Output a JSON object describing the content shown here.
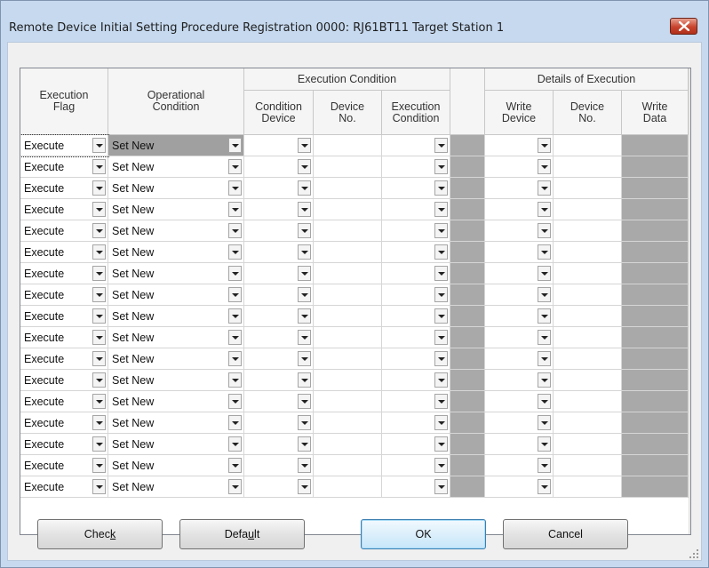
{
  "window": {
    "title": "Remote Device Initial Setting Procedure Registration 0000: RJ61BT11 Target Station 1"
  },
  "grid": {
    "group_headers": {
      "execution_condition": "Execution Condition",
      "details_of_execution": "Details of Execution"
    },
    "columns": {
      "execution_flag": [
        "Execution",
        "Flag"
      ],
      "operational_condition": [
        "Operational",
        "Condition"
      ],
      "condition_device": [
        "Condition",
        "Device"
      ],
      "device_no": [
        "Device",
        "No."
      ],
      "execution_condition": [
        "Execution",
        "Condition"
      ],
      "write_device": [
        "Write",
        "Device"
      ],
      "device_no_2": [
        "Device",
        "No."
      ],
      "write_data": [
        "Write",
        "Data"
      ]
    },
    "rows": [
      {
        "execution_flag": "Execute",
        "operational_condition": "Set New"
      },
      {
        "execution_flag": "Execute",
        "operational_condition": "Set New"
      },
      {
        "execution_flag": "Execute",
        "operational_condition": "Set New"
      },
      {
        "execution_flag": "Execute",
        "operational_condition": "Set New"
      },
      {
        "execution_flag": "Execute",
        "operational_condition": "Set New"
      },
      {
        "execution_flag": "Execute",
        "operational_condition": "Set New"
      },
      {
        "execution_flag": "Execute",
        "operational_condition": "Set New"
      },
      {
        "execution_flag": "Execute",
        "operational_condition": "Set New"
      },
      {
        "execution_flag": "Execute",
        "operational_condition": "Set New"
      },
      {
        "execution_flag": "Execute",
        "operational_condition": "Set New"
      },
      {
        "execution_flag": "Execute",
        "operational_condition": "Set New"
      },
      {
        "execution_flag": "Execute",
        "operational_condition": "Set New"
      },
      {
        "execution_flag": "Execute",
        "operational_condition": "Set New"
      },
      {
        "execution_flag": "Execute",
        "operational_condition": "Set New"
      },
      {
        "execution_flag": "Execute",
        "operational_condition": "Set New"
      },
      {
        "execution_flag": "Execute",
        "operational_condition": "Set New"
      },
      {
        "execution_flag": "Execute",
        "operational_condition": "Set New"
      }
    ],
    "selected_row": 1
  },
  "buttons": {
    "check": "Check",
    "default": "Default",
    "ok": "OK",
    "cancel": "Cancel"
  },
  "colors": {
    "title_bar": "#c6d9ef",
    "gray_cell": "#a9a9a9",
    "selected_cell": "#a0a0a0"
  },
  "icons": {
    "close": "close-icon",
    "dropdown": "chevron-down-icon",
    "scroll_up": "scroll-up-icon",
    "scroll_down": "scroll-down-icon"
  }
}
